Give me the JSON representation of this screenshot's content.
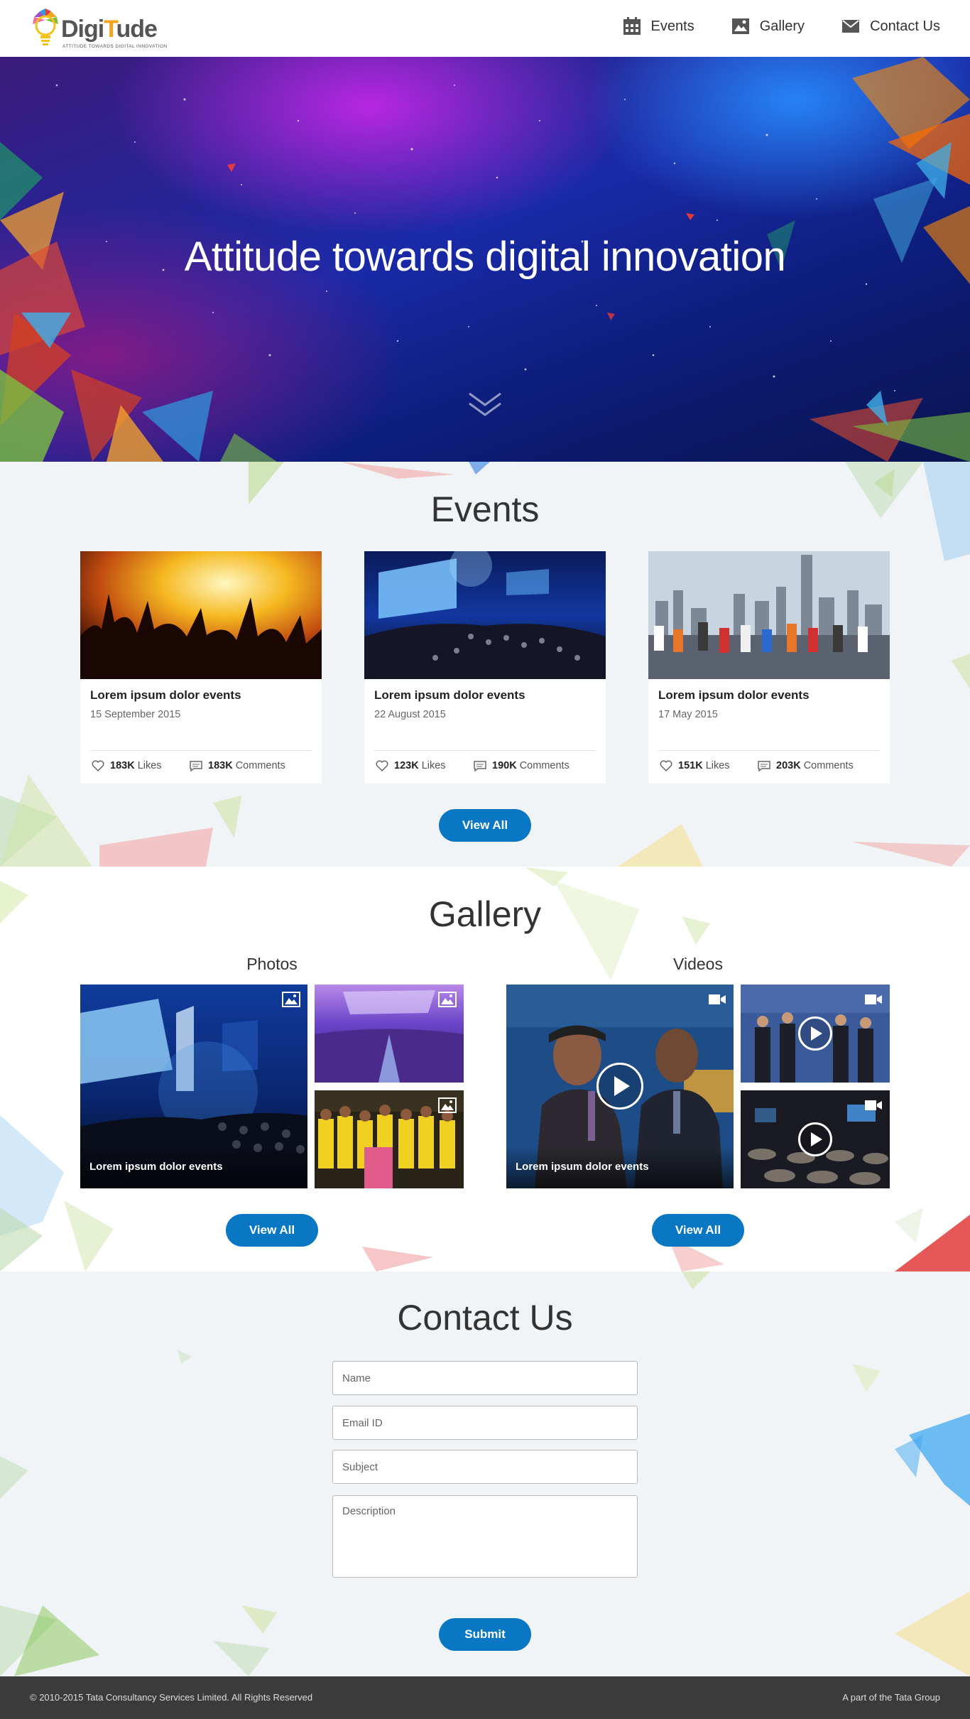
{
  "header": {
    "logo": {
      "name_part1": "Digi",
      "name_accent": "T",
      "name_part2": "ude",
      "tagline": "ATTITUDE TOWARDS DIGITAL INNOVATION"
    },
    "nav": [
      {
        "label": "Events",
        "icon": "calendar-icon"
      },
      {
        "label": "Gallery",
        "icon": "image-icon"
      },
      {
        "label": "Contact Us",
        "icon": "envelope-icon"
      }
    ]
  },
  "hero": {
    "title": "Attitude towards digital innovation",
    "scroll_icon": "chevron-down-icon"
  },
  "events": {
    "title": "Events",
    "cards": [
      {
        "title": "Lorem ipsum dolor events",
        "date": "15 September 2015",
        "likes": "183K",
        "likes_label": "Likes",
        "comments": "183K",
        "comments_label": "Comments"
      },
      {
        "title": "Lorem ipsum dolor events",
        "date": "22 August 2015",
        "likes": "123K",
        "likes_label": "Likes",
        "comments": "190K",
        "comments_label": "Comments"
      },
      {
        "title": "Lorem ipsum dolor events",
        "date": "17 May 2015",
        "likes": "151K",
        "likes_label": "Likes",
        "comments": "203K",
        "comments_label": "Comments"
      }
    ],
    "view_all": "View All"
  },
  "gallery": {
    "title": "Gallery",
    "photos": {
      "title": "Photos",
      "feature_caption": "Lorem ipsum dolor events",
      "view_all": "View All",
      "badge_icon": "image-icon"
    },
    "videos": {
      "title": "Videos",
      "feature_caption": "Lorem ipsum dolor events",
      "view_all": "View All",
      "badge_icon": "video-camera-icon"
    }
  },
  "contact": {
    "title": "Contact Us",
    "name_placeholder": "Name",
    "email_placeholder": "Email ID",
    "subject_placeholder": "Subject",
    "description_placeholder": "Description",
    "submit": "Submit"
  },
  "footer": {
    "copyright": "© 2010-2015 Tata Consultancy Services Limited. All Rights Reserved",
    "group": "A part of the Tata Group"
  },
  "colors": {
    "accent": "#0a77c4",
    "footer_bg": "#3b3b3b",
    "section_bg": "#f1f4f7"
  }
}
